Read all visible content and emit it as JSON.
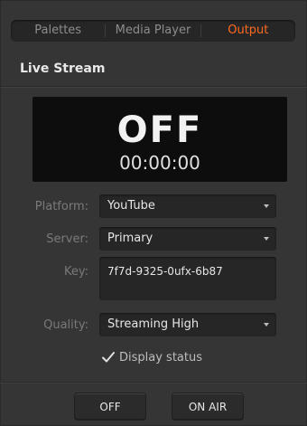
{
  "tabs": [
    {
      "label": "Palettes"
    },
    {
      "label": "Media Player"
    },
    {
      "label": "Output"
    }
  ],
  "active_tab": "Output",
  "section": {
    "title": "Live Stream"
  },
  "status": {
    "state": "OFF",
    "timecode": "00:00:00"
  },
  "fields": {
    "platform": {
      "label": "Platform:",
      "value": "YouTube"
    },
    "server": {
      "label": "Server:",
      "value": "Primary"
    },
    "key": {
      "label": "Key:",
      "value": "7f7d-9325-0ufx-6b87"
    },
    "quality": {
      "label": "Quality:",
      "value": "Streaming High"
    }
  },
  "display_status": {
    "label": "Display status",
    "checked": true
  },
  "buttons": {
    "off_label": "OFF",
    "on_air_label": "ON AIR"
  },
  "colors": {
    "accent": "#ff6a1f",
    "panel": "#353535",
    "field": "#262626"
  },
  "icons": {
    "check": "checkmark-icon",
    "dropdown": "caret-down-icon"
  }
}
